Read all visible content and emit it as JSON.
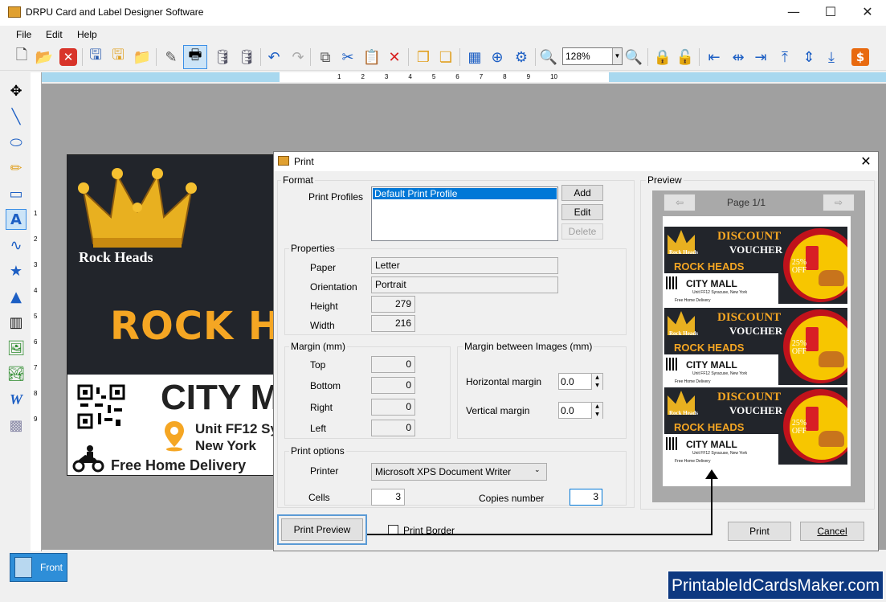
{
  "window": {
    "title": "DRPU Card and Label Designer Software"
  },
  "menu": {
    "items": [
      "File",
      "Edit",
      "Help"
    ]
  },
  "toolbar": {
    "icons": [
      "new-icon",
      "open-icon",
      "close-icon",
      "save-icon",
      "save-as-icon",
      "export-icon",
      "edit-icon",
      "print-icon",
      "database-icon",
      "database-multi-icon",
      "undo-icon",
      "redo-icon",
      "copy-icon",
      "cut-icon",
      "paste-icon",
      "delete-icon",
      "group-icon",
      "ungroup-icon",
      "grid-icon",
      "center-icon",
      "settings-icon",
      "zoom-in-icon",
      "zoom-out-icon",
      "lock-icon",
      "unlock-icon",
      "align-left-icon",
      "align-center-icon",
      "align-right-icon",
      "align-top-icon",
      "align-middle-icon",
      "align-bottom-icon",
      "price-icon"
    ],
    "zoom": "128%"
  },
  "ruler": {
    "ticks": [
      "1",
      "2",
      "3",
      "4",
      "5",
      "6",
      "7",
      "8",
      "9",
      "10"
    ],
    "vticks": [
      "1",
      "2",
      "3",
      "4",
      "5",
      "6",
      "7",
      "8",
      "9"
    ]
  },
  "card": {
    "logo_text": "Rock Heads",
    "headline": "ROCK HEADS",
    "city": "CITY MALL",
    "unit": "Unit FF12 Syracuse,",
    "city_line": "New York",
    "delivery": "Free Home Delivery"
  },
  "tabs": {
    "front": "Front"
  },
  "brand": "PrintableIdCardsMaker.com",
  "dialog": {
    "title": "Print",
    "format": {
      "label": "Format",
      "print_profiles_label": "Print Profiles",
      "profile_selected": "Default Print Profile",
      "add": "Add",
      "edit": "Edit",
      "delete": "Delete"
    },
    "properties": {
      "label": "Properties",
      "paper_label": "Paper",
      "paper": "Letter",
      "orientation_label": "Orientation",
      "orientation": "Portrait",
      "height_label": "Height",
      "height": "279",
      "width_label": "Width",
      "width": "216"
    },
    "margin": {
      "label": "Margin (mm)",
      "top_label": "Top",
      "top": "0",
      "bottom_label": "Bottom",
      "bottom": "0",
      "right_label": "Right",
      "right": "0",
      "left_label": "Left",
      "left": "0"
    },
    "margin_images": {
      "label": "Margin between Images (mm)",
      "horizontal_label": "Horizontal margin",
      "horizontal": "0.0",
      "vertical_label": "Vertical margin",
      "vertical": "0.0"
    },
    "print_options": {
      "label": "Print options",
      "printer_label": "Printer",
      "printer": "Microsoft XPS Document Writer",
      "cells_label": "Cells",
      "cells": "3",
      "copies_label": "Copies number",
      "copies": "3"
    },
    "preview": {
      "label": "Preview",
      "page": "Page 1/1",
      "voucher": {
        "logo": "Rock Heads",
        "discount": "DISCOUNT",
        "voucher": "VOUCHER",
        "rock": "ROCK HEADS",
        "city": "CITY MALL",
        "unit": "Unit FF12 Syracuse, New York",
        "free": "Free Home Delivery",
        "pct": "25%",
        "off": "OFF"
      }
    },
    "print_preview": "Print Preview",
    "print_border": "Print Border",
    "print": "Print",
    "cancel": "Cancel"
  }
}
